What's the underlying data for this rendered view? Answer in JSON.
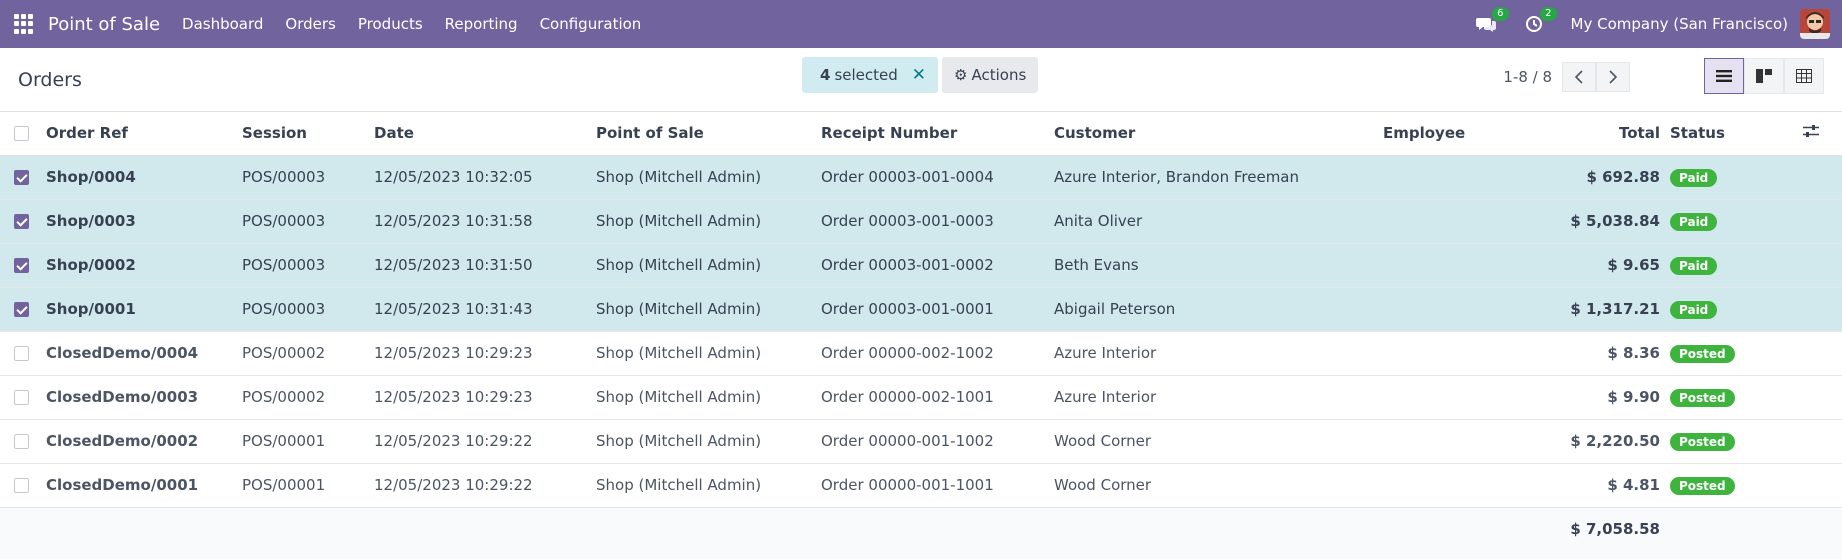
{
  "navbar": {
    "brand": "Point of Sale",
    "menu": [
      "Dashboard",
      "Orders",
      "Products",
      "Reporting",
      "Configuration"
    ],
    "messages_count": "6",
    "activities_count": "2",
    "company": "My Company (San Francisco)"
  },
  "control": {
    "title": "Orders",
    "selected_count": "4",
    "selected_label": "selected",
    "actions_label": "Actions",
    "pager": "1-8 / 8"
  },
  "table": {
    "headers": {
      "order_ref": "Order Ref",
      "session": "Session",
      "date": "Date",
      "pos": "Point of Sale",
      "receipt": "Receipt Number",
      "customer": "Customer",
      "employee": "Employee",
      "total": "Total",
      "status": "Status"
    },
    "rows": [
      {
        "selected": true,
        "ref": "Shop/0004",
        "session": "POS/00003",
        "date": "12/05/2023 10:32:05",
        "pos": "Shop (Mitchell Admin)",
        "receipt": "Order 00003-001-0004",
        "customer": "Azure Interior, Brandon Freeman",
        "employee": "",
        "total": "$ 692.88",
        "status": "Paid"
      },
      {
        "selected": true,
        "ref": "Shop/0003",
        "session": "POS/00003",
        "date": "12/05/2023 10:31:58",
        "pos": "Shop (Mitchell Admin)",
        "receipt": "Order 00003-001-0003",
        "customer": "Anita Oliver",
        "employee": "",
        "total": "$ 5,038.84",
        "status": "Paid"
      },
      {
        "selected": true,
        "ref": "Shop/0002",
        "session": "POS/00003",
        "date": "12/05/2023 10:31:50",
        "pos": "Shop (Mitchell Admin)",
        "receipt": "Order 00003-001-0002",
        "customer": "Beth Evans",
        "employee": "",
        "total": "$ 9.65",
        "status": "Paid"
      },
      {
        "selected": true,
        "ref": "Shop/0001",
        "session": "POS/00003",
        "date": "12/05/2023 10:31:43",
        "pos": "Shop (Mitchell Admin)",
        "receipt": "Order 00003-001-0001",
        "customer": "Abigail Peterson",
        "employee": "",
        "total": "$ 1,317.21",
        "status": "Paid"
      },
      {
        "selected": false,
        "ref": "ClosedDemo/0004",
        "session": "POS/00002",
        "date": "12/05/2023 10:29:23",
        "pos": "Shop (Mitchell Admin)",
        "receipt": "Order 00000-002-1002",
        "customer": "Azure Interior",
        "employee": "",
        "total": "$ 8.36",
        "status": "Posted"
      },
      {
        "selected": false,
        "ref": "ClosedDemo/0003",
        "session": "POS/00002",
        "date": "12/05/2023 10:29:23",
        "pos": "Shop (Mitchell Admin)",
        "receipt": "Order 00000-002-1001",
        "customer": "Azure Interior",
        "employee": "",
        "total": "$ 9.90",
        "status": "Posted"
      },
      {
        "selected": false,
        "ref": "ClosedDemo/0002",
        "session": "POS/00001",
        "date": "12/05/2023 10:29:22",
        "pos": "Shop (Mitchell Admin)",
        "receipt": "Order 00000-001-1002",
        "customer": "Wood Corner",
        "employee": "",
        "total": "$ 2,220.50",
        "status": "Posted"
      },
      {
        "selected": false,
        "ref": "ClosedDemo/0001",
        "session": "POS/00001",
        "date": "12/05/2023 10:29:22",
        "pos": "Shop (Mitchell Admin)",
        "receipt": "Order 00000-001-1001",
        "customer": "Wood Corner",
        "employee": "",
        "total": "$ 4.81",
        "status": "Posted"
      }
    ],
    "grand_total": "$ 7,058.58"
  },
  "colors": {
    "navbar": "#71639e",
    "selected_row": "#d1e9ec",
    "status_badge": "#3eb33e"
  }
}
